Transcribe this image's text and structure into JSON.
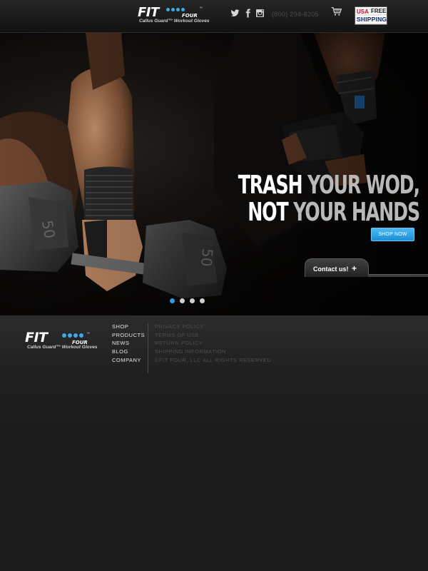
{
  "header": {
    "logo": {
      "word": "FIT",
      "sub": "FOUR",
      "tagline": "Callus Guard™ Workout Gloves",
      "tm": "™"
    },
    "social": [
      {
        "icon": "twitter-icon"
      },
      {
        "icon": "facebook-icon"
      },
      {
        "icon": "instagram-icon"
      }
    ],
    "phone": "(800) 294-8205",
    "cart_icon": "shopping-cart-icon",
    "badge": {
      "usa": "USA",
      "free": "FREE",
      "shipping": "SHIPPING"
    }
  },
  "hero": {
    "headline_line1_white": "TRASH ",
    "headline_line1_gray": "YOUR WOD,",
    "headline_line2_white": "NOT ",
    "headline_line2_gray": "YOUR HANDS",
    "shop_button": "SHOP NOW",
    "contact_label": "Contact us!",
    "contact_plus": "+",
    "slides": 4,
    "active_slide": 1,
    "dumbbell_labels": [
      "50",
      "50"
    ]
  },
  "footer": {
    "logo": {
      "word": "FIT",
      "sub": "FOUR",
      "tagline": "Callus Guard™ Workout Gloves",
      "tm": "™"
    },
    "nav": [
      "SHOP",
      "PRODUCTS",
      "NEWS",
      "BLOG",
      "COMPANY"
    ],
    "legal": [
      "PRIVACY POLICY",
      "TERMS OF USE",
      "RETURN POLICY",
      "SHIPPING INFORMATION",
      "©FIT FOUR, LLC ALL RIGHTS RESERVED"
    ]
  },
  "colors": {
    "accent_blue": "#2a9ee6",
    "button_blue": "#1a8fd8",
    "background": "#1b1b1b"
  }
}
